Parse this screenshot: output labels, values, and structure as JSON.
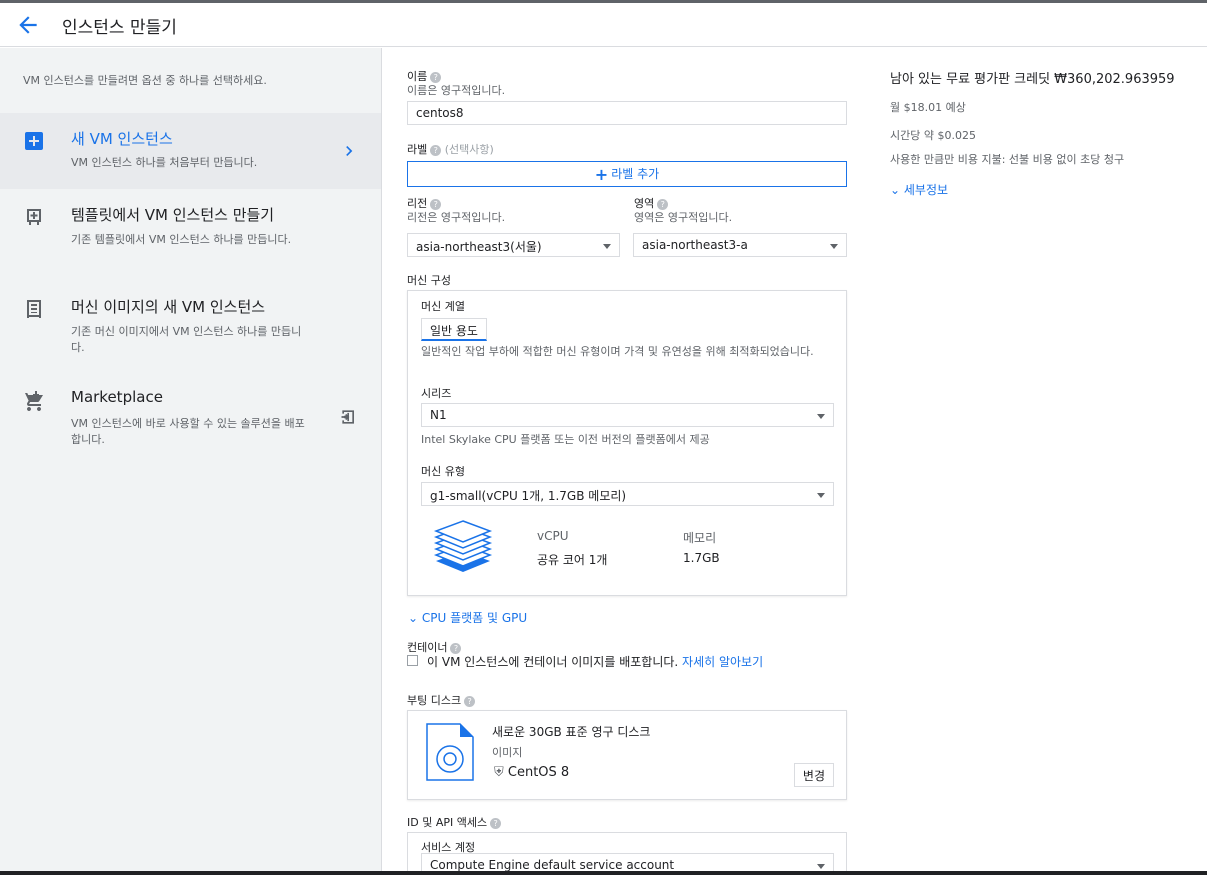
{
  "header": {
    "title": "인스턴스 만들기"
  },
  "left": {
    "intro": "VM 인스턴스를 만들려면 옵션 중 하나를 선택하세요.",
    "options": [
      {
        "title": "새 VM 인스턴스",
        "desc": "VM 인스턴스 하나를 처음부터 만듭니다.",
        "icon": "add-box-icon",
        "active": true
      },
      {
        "title": "템플릿에서 VM 인스턴스 만들기",
        "desc": "기존 템플릿에서 VM 인스턴스 하나를 만듭니다.",
        "icon": "template-icon"
      },
      {
        "title": "머신 이미지의 새 VM 인스턴스",
        "desc": "기존 머신 이미지에서 VM 인스턴스 하나를 만듭니다.",
        "icon": "machine-image-icon"
      },
      {
        "title": "Marketplace",
        "desc": "VM 인스턴스에 바로 사용할 수 있는 솔루션을 배포합니다.",
        "icon": "cart-icon"
      }
    ]
  },
  "form": {
    "name": {
      "label": "이름",
      "hint": "이름은 영구적입니다.",
      "value": "centos8"
    },
    "labels": {
      "label": "라벨",
      "optional": "(선택사항)",
      "add_button": "라벨 추가"
    },
    "region": {
      "label": "리전",
      "hint": "리전은 영구적입니다.",
      "value": "asia-northeast3(서울)"
    },
    "zone": {
      "label": "영역",
      "hint": "영역은 영구적입니다.",
      "value": "asia-northeast3-a"
    },
    "machine_config": {
      "label": "머신 구성",
      "family_label": "머신 계열",
      "family_tab": "일반 용도",
      "family_desc": "일반적인 작업 부하에 적합한 머신 유형이며 가격 및 유연성을 위해 최적화되었습니다.",
      "series_label": "시리즈",
      "series_value": "N1",
      "series_desc": "Intel Skylake CPU 플랫폼 또는 이전 버전의 플랫폼에서 제공",
      "type_label": "머신 유형",
      "type_value": "g1-small(vCPU 1개, 1.7GB 메모리)",
      "vcpu_header": "vCPU",
      "vcpu_value": "공유 코어 1개",
      "memory_header": "메모리",
      "memory_value": "1.7GB"
    },
    "cpu_gpu_link": "CPU 플랫폼 및 GPU",
    "container": {
      "label": "컨테이너",
      "checkbox_text": "이 VM 인스턴스에 컨테이너 이미지를 배포합니다.",
      "learn_more": "자세히 알아보기"
    },
    "boot_disk": {
      "label": "부팅 디스크",
      "title": "새로운 30GB 표준 영구 디스크",
      "image_label": "이미지",
      "image_value": "CentOS 8",
      "change_button": "변경"
    },
    "identity": {
      "label": "ID 및 API 액세스",
      "service_account_label": "서비스 계정",
      "service_account_value": "Compute Engine default service account"
    }
  },
  "right": {
    "credit": "남아 있는 무료 평가판 크레딧 ₩360,202.963959",
    "monthly": "월 $18.01 예상",
    "hourly": "시간당 약 $0.025",
    "billing_note": "사용한 만큼만 비용 지불: 선불 비용 없이 초당 청구",
    "details_link": "세부정보"
  },
  "colors": {
    "accent": "#1a73e8",
    "left_bg": "#f1f3f4",
    "active_bg": "#e8eaed"
  }
}
